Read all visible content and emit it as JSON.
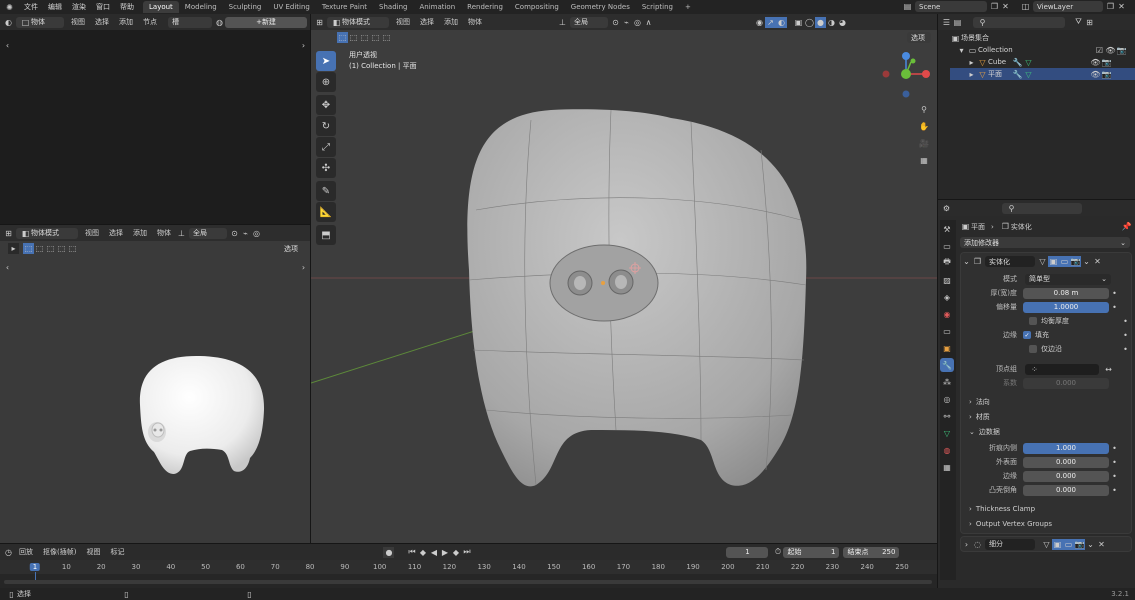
{
  "topmenu": {
    "items": [
      "文件",
      "编辑",
      "渲染",
      "窗口",
      "帮助"
    ]
  },
  "workspaces": [
    "Layout",
    "Modeling",
    "Sculpting",
    "UV Editing",
    "Texture Paint",
    "Shading",
    "Animation",
    "Rendering",
    "Compositing",
    "Geometry Nodes",
    "Scripting"
  ],
  "scene": {
    "name": "Scene",
    "viewlayer": "ViewLayer"
  },
  "node_editor": {
    "mode": "物体",
    "menus": [
      "视图",
      "选择",
      "添加",
      "节点"
    ],
    "slot": "槽",
    "new_btn": "新建"
  },
  "viewport_small": {
    "mode": "物体模式",
    "menus": [
      "视图",
      "选择",
      "添加",
      "物体"
    ],
    "orient": "全局",
    "options": "选项"
  },
  "viewport_main": {
    "mode": "物体模式",
    "menus": [
      "视图",
      "选择",
      "添加",
      "物体"
    ],
    "orient": "全局",
    "options": "选项",
    "view_name": "用户透视",
    "collection_line": "(1) Collection | 平面"
  },
  "outliner": {
    "root": "场景集合",
    "items": [
      {
        "name": "Collection",
        "depth": 0
      },
      {
        "name": "Cube",
        "depth": 1
      },
      {
        "name": "平面",
        "depth": 1
      }
    ]
  },
  "properties": {
    "breadcrumb_obj": "平面",
    "breadcrumb_mod": "实体化",
    "add_modifier": "添加修改器",
    "mod_name": "实体化",
    "rows": {
      "mode_lbl": "模式",
      "mode_val": "简单型",
      "thick_lbl": "厚(宽)度",
      "thick_val": "0.08 m",
      "offset_lbl": "偏移量",
      "offset_val": "1.0000",
      "even_lbl": "均衡厚度",
      "rim_lbl": "边缘",
      "fill_lbl": "填充",
      "rimonly_lbl": "仅边沿",
      "vgroup_lbl": "顶点组",
      "factor_lbl": "系数",
      "factor_val": "0.000"
    },
    "sections": {
      "normals": "法向",
      "materials": "材质",
      "edge_data": "边数据"
    },
    "edge_rows": {
      "crease_inner_lbl": "折痕内侧",
      "crease_inner_val": "1.000",
      "outer_lbl": "外表面",
      "outer_val": "0.000",
      "rim_lbl": "边缘",
      "rim_val": "0.000",
      "bevel_lbl": "凸壳倒角",
      "bevel_val": "0.000"
    },
    "thickness_clamp": "Thickness Clamp",
    "output_vgroups": "Output Vertex Groups",
    "mod2_name": "细分"
  },
  "timeline": {
    "menus": [
      "回放",
      "抠像(插帧)",
      "视图",
      "标记"
    ],
    "current": "1",
    "start_lbl": "起始",
    "start": "1",
    "end_lbl": "结束点",
    "end": "250",
    "ticks": [
      "1",
      "10",
      "20",
      "30",
      "40",
      "50",
      "60",
      "70",
      "80",
      "90",
      "100",
      "110",
      "120",
      "130",
      "140",
      "150",
      "160",
      "170",
      "180",
      "190",
      "200",
      "210",
      "220",
      "230",
      "240",
      "250"
    ]
  },
  "statusbar": {
    "left": "选择",
    "version": "3.2.1"
  },
  "colors": {
    "accent": "#4772b3",
    "active_frame": "#4772b3"
  }
}
